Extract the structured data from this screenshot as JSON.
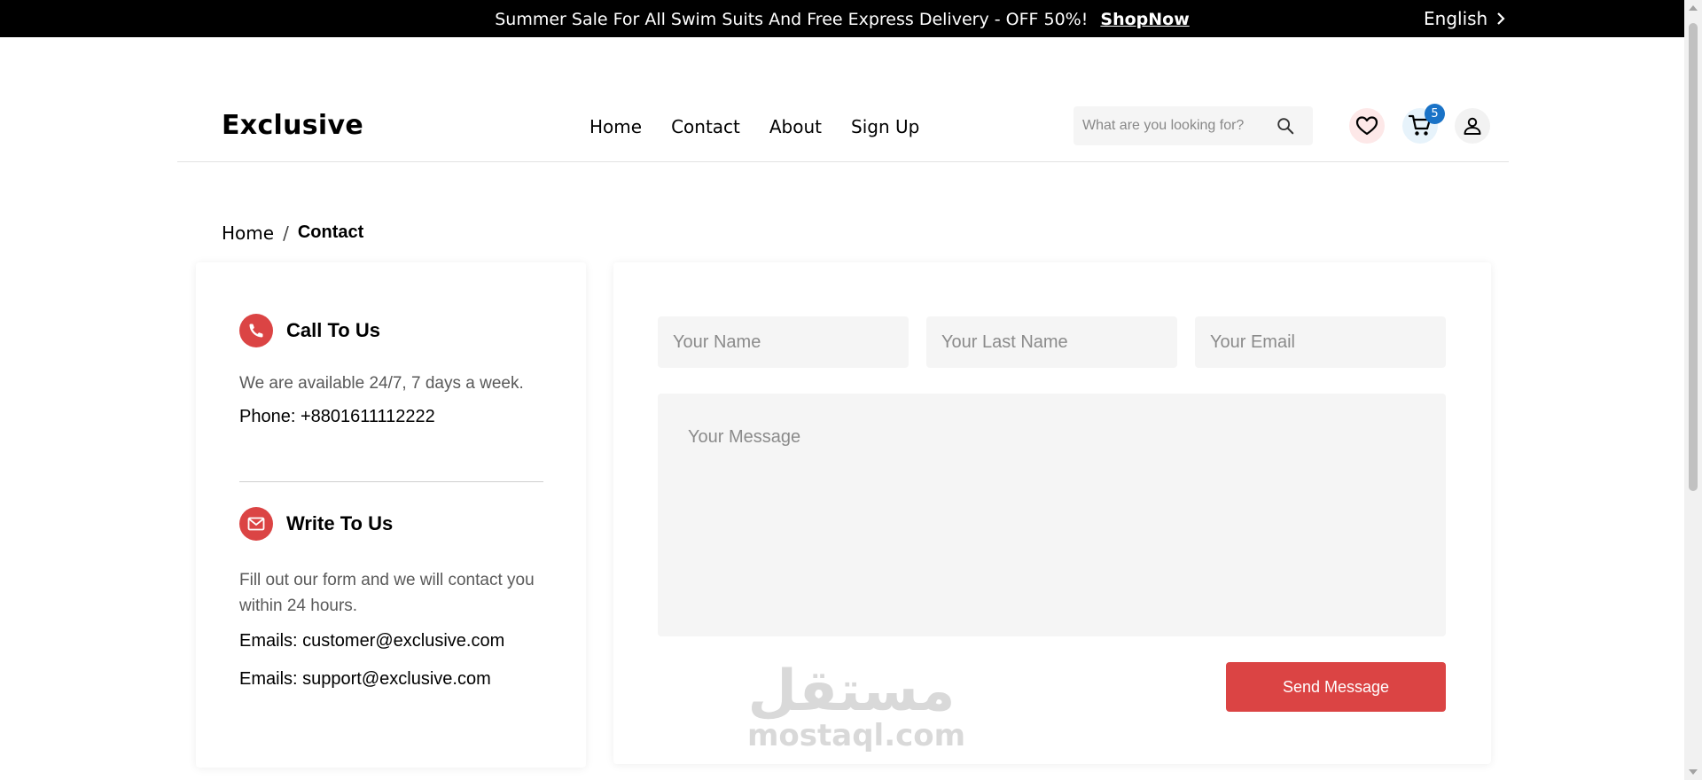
{
  "announcement": {
    "text": "Summer Sale For All Swim Suits And Free Express Delivery - OFF 50%!",
    "link": "ShopNow",
    "language": "English"
  },
  "header": {
    "logo": "Exclusive",
    "nav": [
      "Home",
      "Contact",
      "About",
      "Sign Up"
    ],
    "search_placeholder": "What are you looking for?",
    "cart_count": "5",
    "icons": [
      "search-icon",
      "heart-icon",
      "cart-icon",
      "user-icon"
    ]
  },
  "breadcrumb": {
    "home": "Home",
    "separator": "/",
    "current": "Contact"
  },
  "contact_info": {
    "call": {
      "title": "Call To Us",
      "description": "We are available 24/7, 7 days a week.",
      "phone": "Phone: +8801611112222"
    },
    "write": {
      "title": "Write To Us",
      "description": "Fill out our form and we will contact you within 24 hours.",
      "email_1": "Emails: customer@exclusive.com",
      "email_2": "Emails: support@exclusive.com"
    }
  },
  "form": {
    "name_placeholder": "Your Name",
    "last_name_placeholder": "Your Last Name",
    "email_placeholder": "Your Email",
    "message_placeholder": "Your Message",
    "send_label": "Send Message"
  },
  "watermark": {
    "arabic": "مستقل",
    "latin": "mostaql.com"
  },
  "colors": {
    "accent": "#db4444",
    "badge": "#1a73c7",
    "field_bg": "#f5f5f5",
    "topbar_bg": "#000000"
  }
}
